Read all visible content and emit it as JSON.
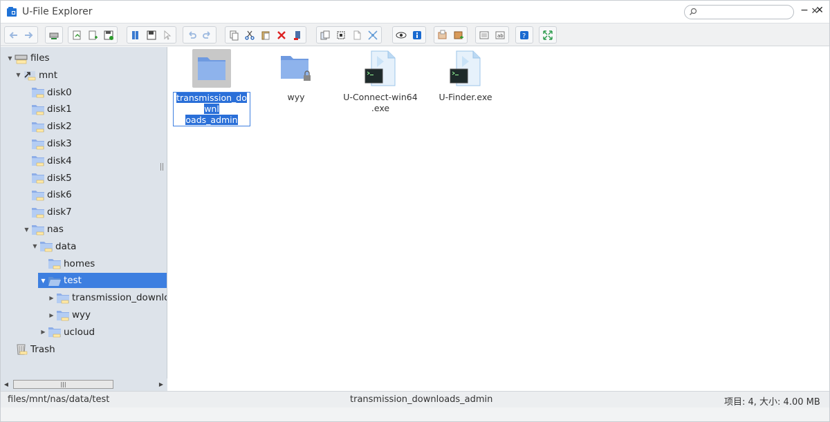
{
  "window": {
    "title": "U-File Explorer"
  },
  "toolbar": {
    "groups": [
      [
        "back-icon",
        "forward-icon"
      ],
      [
        "drive-icon"
      ],
      [
        "open-icon",
        "new-file-icon",
        "save-icon"
      ],
      [
        "book-icon",
        "floppy-icon",
        "select-icon"
      ],
      [
        "undo-icon",
        "redo-icon"
      ],
      [
        "copy-icon",
        "cut-icon",
        "paste-icon",
        "delete-icon",
        "rm-icon"
      ],
      [
        "duplicate-icon",
        "select-all-icon",
        "new-doc-icon",
        "resize-icon"
      ],
      [
        "view-icon",
        "info-icon"
      ],
      [
        "extract-icon",
        "archive-icon"
      ],
      [
        "list-view-icon",
        "rename-icon"
      ],
      [
        "help-icon"
      ],
      [
        "fullscreen-icon"
      ]
    ]
  },
  "search": {
    "placeholder": "",
    "value": ""
  },
  "tree": [
    {
      "label": "files",
      "depth": 0,
      "expanded": true,
      "icon": "drive"
    },
    {
      "label": "mnt",
      "depth": 1,
      "expanded": true,
      "icon": "link-folder"
    },
    {
      "label": "disk0",
      "depth": 2,
      "icon": "folder"
    },
    {
      "label": "disk1",
      "depth": 2,
      "icon": "folder"
    },
    {
      "label": "disk2",
      "depth": 2,
      "icon": "folder"
    },
    {
      "label": "disk3",
      "depth": 2,
      "icon": "folder"
    },
    {
      "label": "disk4",
      "depth": 2,
      "icon": "folder"
    },
    {
      "label": "disk5",
      "depth": 2,
      "icon": "folder"
    },
    {
      "label": "disk6",
      "depth": 2,
      "icon": "folder"
    },
    {
      "label": "disk7",
      "depth": 2,
      "icon": "folder"
    },
    {
      "label": "nas",
      "depth": 2,
      "expanded": true,
      "icon": "folder"
    },
    {
      "label": "data",
      "depth": 3,
      "expanded": true,
      "icon": "folder"
    },
    {
      "label": "homes",
      "depth": 4,
      "icon": "folder"
    },
    {
      "label": "test",
      "depth": 4,
      "expanded": true,
      "selected": true,
      "icon": "folder-open"
    },
    {
      "label": "transmission_downloads_admin",
      "depth": 5,
      "collapsed": true,
      "icon": "folder"
    },
    {
      "label": "wyy",
      "depth": 5,
      "collapsed": true,
      "icon": "folder"
    },
    {
      "label": "ucloud",
      "depth": 4,
      "collapsed": true,
      "icon": "folder"
    },
    {
      "label": "Trash",
      "depth": 0,
      "icon": "trash"
    }
  ],
  "items": [
    {
      "name": "transmission_downloads_admin",
      "line1": "transmission_downl",
      "line2": "oads_admin",
      "type": "folder",
      "selected": true
    },
    {
      "name": "wyy",
      "line1": "wyy",
      "line2": "",
      "type": "folder-locked"
    },
    {
      "name": "U-Connect-win64.exe",
      "line1": "U-Connect-win64",
      "line2": ".exe",
      "type": "exe"
    },
    {
      "name": "U-Finder.exe",
      "line1": "U-Finder.exe",
      "line2": "",
      "type": "exe"
    }
  ],
  "status": {
    "path": "files/mnt/nas/data/test",
    "selection": "transmission_downloads_admin",
    "info": "项目: 4, 大小: 4.00 MB"
  },
  "colors": {
    "accent": "#3d7fe0",
    "sidebar": "#dde3ea",
    "folder": "#8eaee8"
  }
}
